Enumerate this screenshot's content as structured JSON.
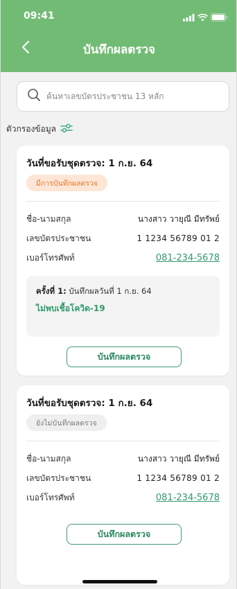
{
  "status": {
    "time": "09:41"
  },
  "header": {
    "title": "บันทึกผลตรวจ"
  },
  "search": {
    "placeholder": "ค้นหาเลขบัตรประชาชน 13 หลัก"
  },
  "filter": {
    "label": "ตัวกรองข้อมูล"
  },
  "colors": {
    "brand_green": "#72bb74",
    "link_green": "#2f9a6a",
    "orange_badge": "#e07a2e"
  },
  "cards": [
    {
      "heading": "วันที่ขอรับชุดตรวจ: 1 ก.ย. 64",
      "badge": "มีการบันทึกผลตรวจ",
      "name_label": "ชื่อ-นามสกุล",
      "name_value": "นางสาว วายุณี มีทรัพย์",
      "id_label": "เลขบัตรประชาชน",
      "id_value": "1 1234 56789 01 2",
      "phone_label": "เบอร์โทรศัพท์",
      "phone_value": "081-234-5678",
      "history_round": "ครั้งที่ 1:",
      "history_text": " บันทึกผลวันที่ 1 ก.ย. 64",
      "history_result": "ไม่พบเชื้อโควิด-19",
      "button": "บันทึกผลตรวจ"
    },
    {
      "heading": "วันที่ขอรับชุดตรวจ: 1 ก.ย. 64",
      "badge": "ยังไม่บันทึกผลตรวจ",
      "name_label": "ชื่อ-นามสกุล",
      "name_value": "นางสาว วายุณี มีทรัพย์",
      "id_label": "เลขบัตรประชาชน",
      "id_value": "1 1234 56789 01 2",
      "phone_label": "เบอร์โทรศัพท์",
      "phone_value": "081-234-5678",
      "button": "บันทึกผลตรวจ"
    }
  ]
}
